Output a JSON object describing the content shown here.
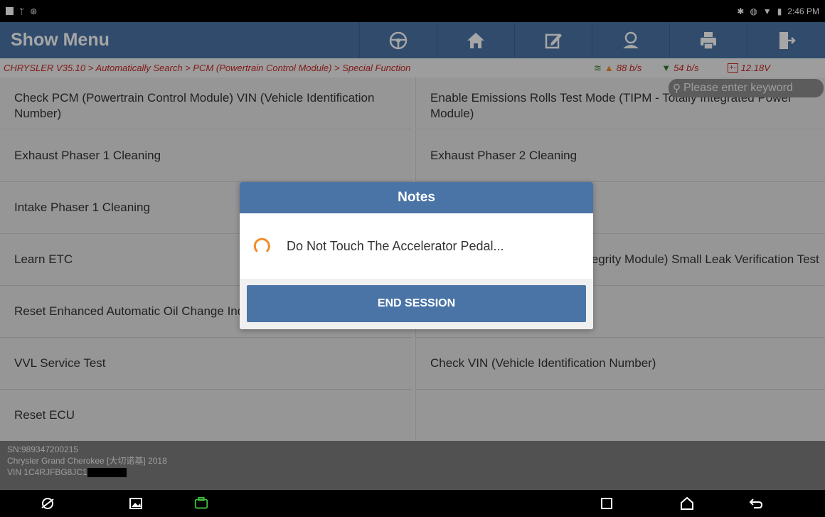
{
  "status_bar": {
    "time": "2:46 PM"
  },
  "header": {
    "title": "Show Menu"
  },
  "toolbar": {
    "buttons": [
      "steering-wheel-icon",
      "home-icon",
      "edit-icon",
      "user-icon",
      "print-icon",
      "exit-icon"
    ]
  },
  "breadcrumb": {
    "path": "CHRYSLER V35.10 > Automatically Search > PCM (Powertrain Control Module) > Special Function",
    "upload": "88 b/s",
    "download": "54 b/s",
    "voltage": "12.18V"
  },
  "search": {
    "placeholder": "Please enter keyword"
  },
  "menu": {
    "left": [
      "Check PCM (Powertrain Control Module) VIN (Vehicle Identification Number)",
      "Exhaust Phaser 1 Cleaning",
      "Intake Phaser 1 Cleaning",
      "Learn ETC",
      "Reset Enhanced Automatic Oil Change Indicator",
      "VVL Service Test",
      "Reset ECU"
    ],
    "right": [
      "Enable Emissions Rolls Test Mode (TIPM - Totally Integrated Power Module)",
      "Exhaust Phaser 2 Cleaning",
      "",
      "ESIM (Evaporative System Integrity Module) Small Leak Verification Test",
      "",
      "Check VIN (Vehicle Identification Number)",
      ""
    ]
  },
  "vehicle": {
    "sn": "SN:989347200215",
    "model": "Chrysler Grand Cherokee [大切诺基] 2018",
    "vin": "VIN 1C4RJFBG8JC1"
  },
  "modal": {
    "title": "Notes",
    "message": "Do Not Touch The Accelerator Pedal...",
    "button": "END SESSION"
  },
  "colors": {
    "brand": "#4a74a6",
    "accent_red": "#c62828",
    "spinner": "#f28c28"
  }
}
